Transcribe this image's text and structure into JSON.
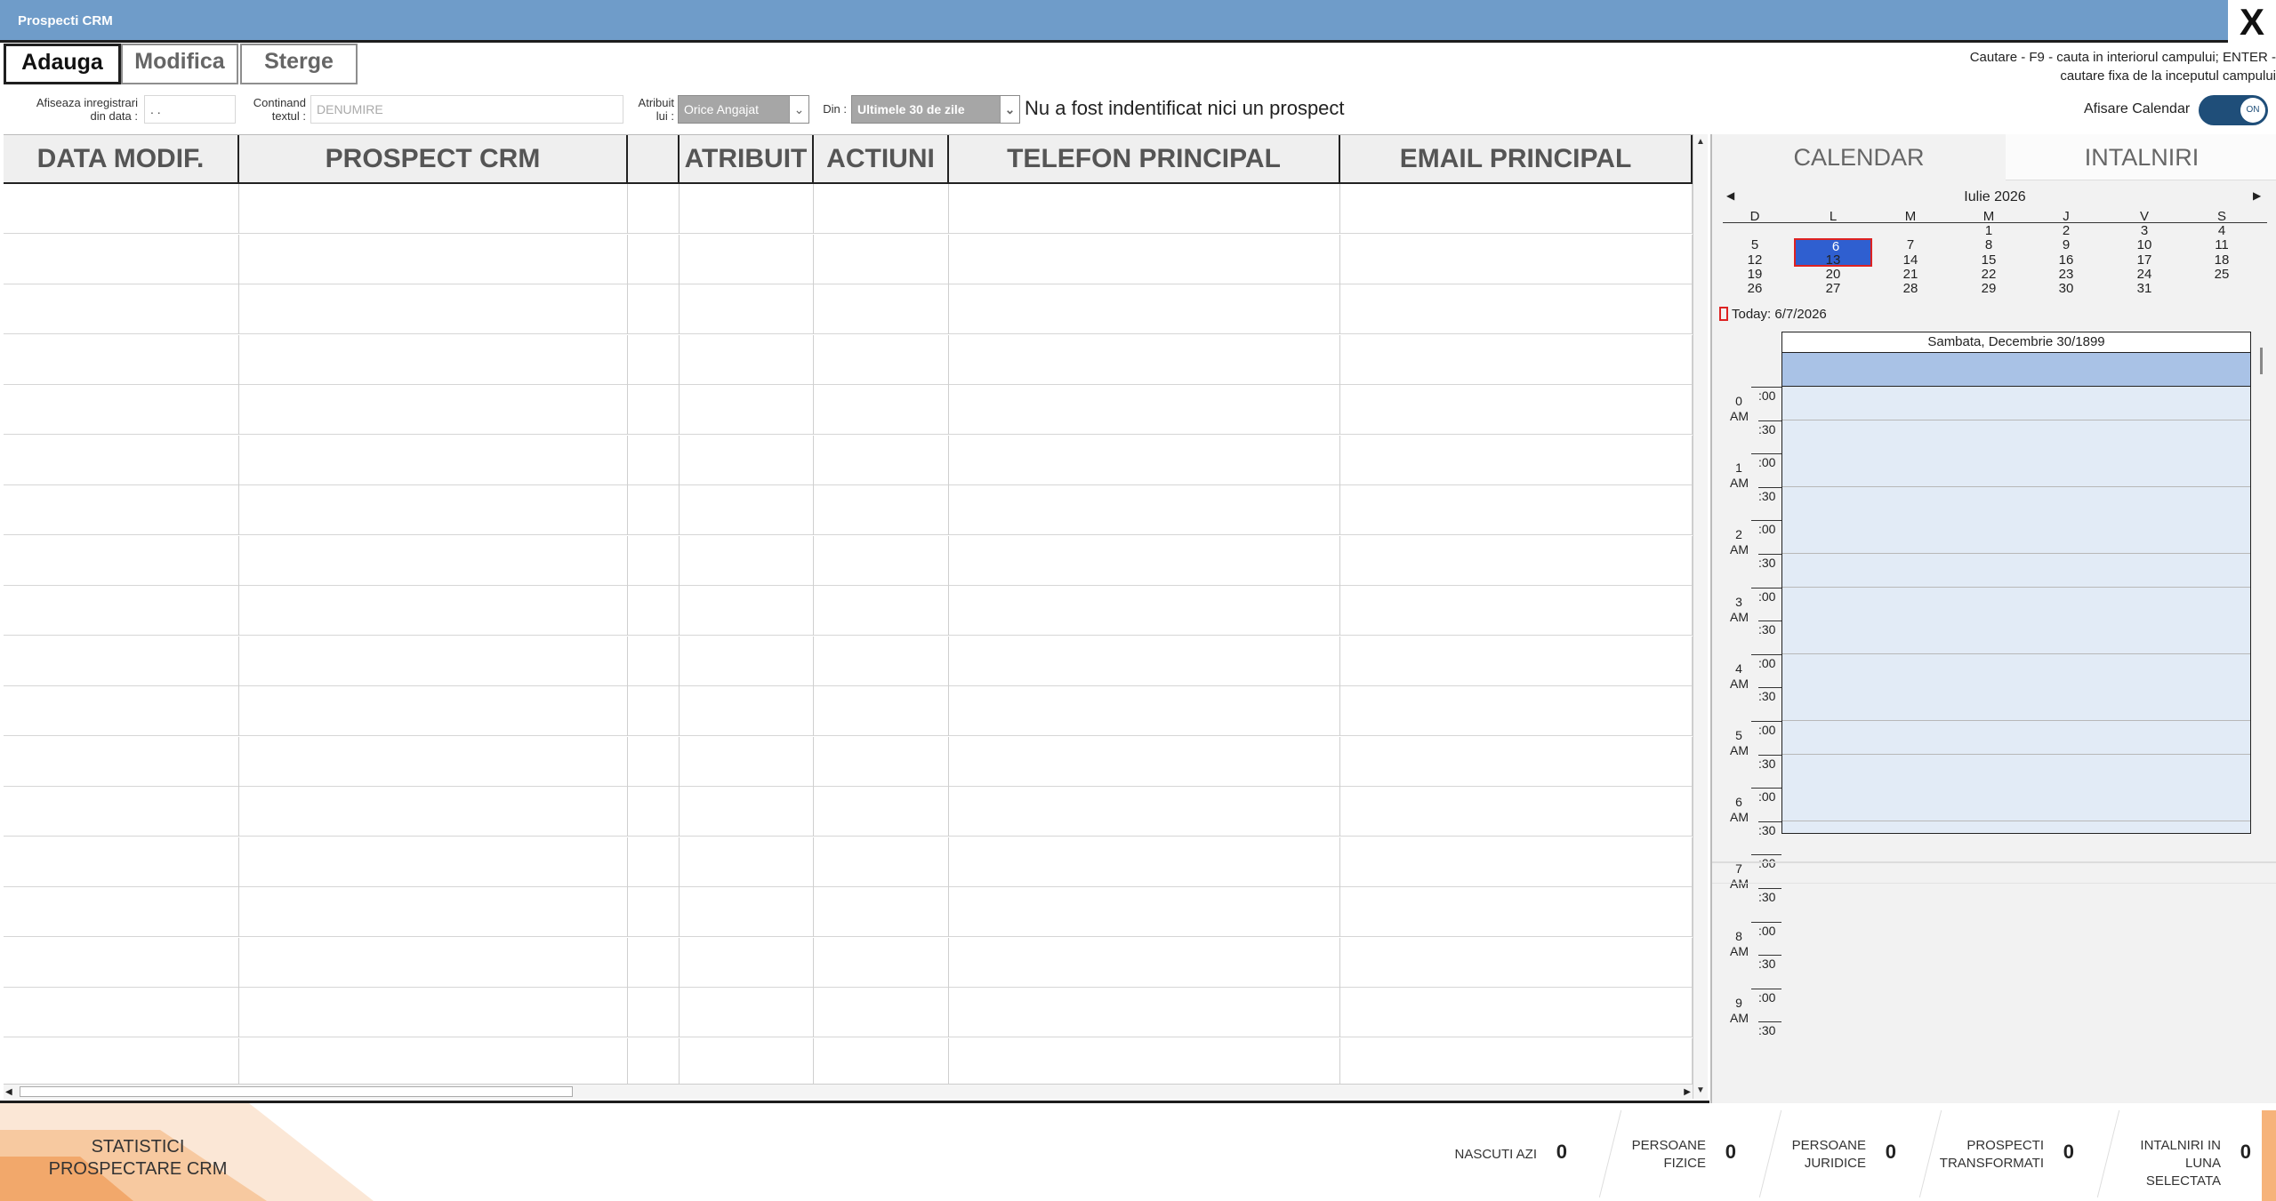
{
  "window": {
    "title": "Prospecti CRM",
    "close_label": "X"
  },
  "toolbar": {
    "add_label": "Adauga",
    "edit_label": "Modifica",
    "delete_label": "Sterge"
  },
  "search_help": {
    "line1": "Cautare - F9 - cauta in interiorul campului; ENTER -",
    "line2": "cautare fixa de la inceputul campului"
  },
  "filters": {
    "date_label_1": "Afiseaza inregistrari",
    "date_label_2": "din data :",
    "date_value": ". .",
    "text_label_1": "Continand",
    "text_label_2": "textul :",
    "text_placeholder": "DENUMIRE",
    "attr_label_1": "Atribuit",
    "attr_label_2": "lui :",
    "attr_value": "Orice Angajat",
    "from_label": "Din :",
    "from_value": "Ultimele 30 de zile",
    "status_message": "Nu a fost indentificat nici un prospect",
    "calendar_toggle_label": "Afisare Calendar",
    "calendar_toggle_state": "ON"
  },
  "grid": {
    "columns": [
      "DATA MODIF.",
      "PROSPECT CRM",
      "",
      "ATRIBUIT",
      "ACTIUNI",
      "TELEFON PRINCIPAL",
      "EMAIL PRINCIPAL"
    ],
    "rows": []
  },
  "panel": {
    "tabs": [
      "CALENDAR",
      "INTALNIRI"
    ],
    "calendar": {
      "month_label": "Iulie 2026",
      "weekdays": [
        "D",
        "L",
        "M",
        "M",
        "J",
        "V",
        "S"
      ],
      "weeks": [
        [
          "",
          "",
          "",
          "1",
          "2",
          "3",
          "4"
        ],
        [
          "5",
          "6",
          "7",
          "8",
          "9",
          "10",
          "11"
        ],
        [
          "12",
          "13",
          "14",
          "15",
          "16",
          "17",
          "18"
        ],
        [
          "19",
          "20",
          "21",
          "22",
          "23",
          "24",
          "25"
        ],
        [
          "26",
          "27",
          "28",
          "29",
          "30",
          "31",
          ""
        ]
      ],
      "selected_day": "6",
      "today_label": "Today: 6/7/2026"
    },
    "schedule": {
      "day_header": "Sambata, Decembrie 30/1899",
      "hours": [
        {
          "h": "0",
          "ap": "AM"
        },
        {
          "h": "1",
          "ap": "AM"
        },
        {
          "h": "2",
          "ap": "AM"
        },
        {
          "h": "3",
          "ap": "AM"
        },
        {
          "h": "4",
          "ap": "AM"
        },
        {
          "h": "5",
          "ap": "AM"
        },
        {
          "h": "6",
          "ap": "AM"
        },
        {
          "h": "7",
          "ap": "AM"
        },
        {
          "h": "8",
          "ap": "AM"
        },
        {
          "h": "9",
          "ap": "AM"
        }
      ],
      "minute_labels": [
        ":00",
        ":30"
      ]
    }
  },
  "footer": {
    "stats_title_1": "STATISTICI",
    "stats_title_2": "PROSPECTARE CRM",
    "stats": [
      {
        "label_1": "",
        "label_2": "NASCUTI AZI",
        "value": "0"
      },
      {
        "label_1": "PERSOANE",
        "label_2": "FIZICE",
        "value": "0"
      },
      {
        "label_1": "PERSOANE",
        "label_2": "JURIDICE",
        "value": "0"
      },
      {
        "label_1": "PROSPECTI",
        "label_2": "TRANSFORMATI",
        "value": "0"
      },
      {
        "label_1": "INTALNIRI IN",
        "label_2": "LUNA SELECTATA",
        "value": "0"
      }
    ]
  },
  "colors": {
    "titlebar": "#6f9cc9",
    "selected_day": "#2f5fd0",
    "allday_band": "#a9c2e6",
    "work_hours": "#e2ebf6",
    "toggle_on": "#1f4e79",
    "footer_accent": "#f6b37a"
  }
}
